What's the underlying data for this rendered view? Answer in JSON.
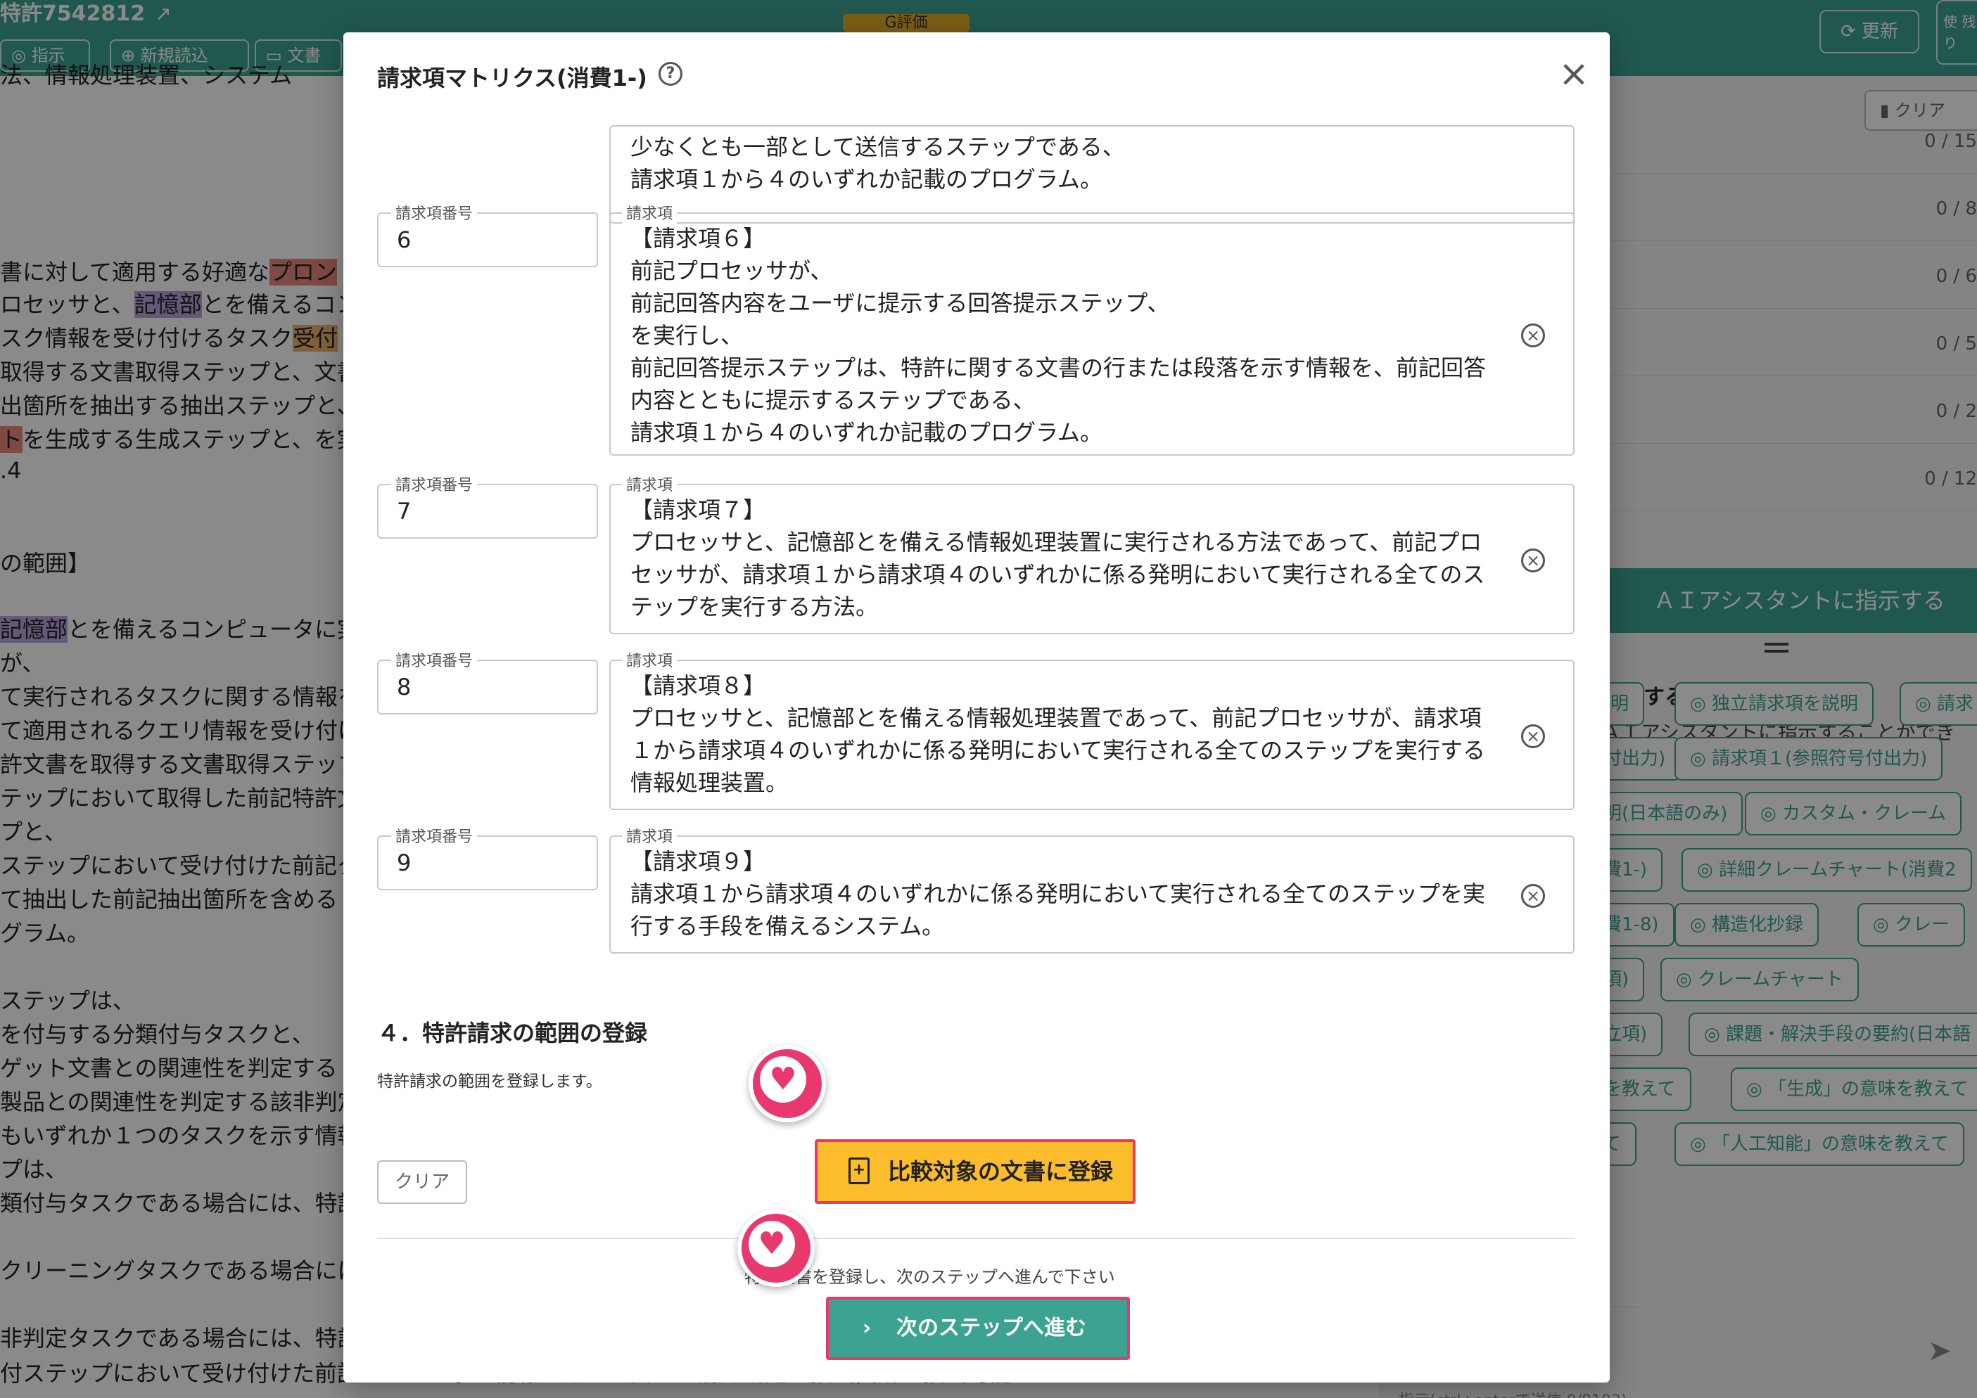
{
  "app": {
    "title": "特許7542812",
    "toolbar": [
      "指示",
      "新規読込",
      "文書"
    ],
    "rating": "G評価",
    "update_label": "更新",
    "remaining_label": "使 残り"
  },
  "doc_lines": [
    {
      "text": "法、情報処理装置、システム"
    },
    {
      "text": "書に対して適用する好適な",
      "hl": "プロン",
      "hlclass": "hl-red"
    },
    {
      "text": "ロセッサと、",
      "hl": "記憶部",
      "hlclass": "hl-purple",
      "after": "とを備えるコン"
    },
    {
      "text": "スク情報を受け付けるタスク",
      "hl": "受付",
      "hlclass": "hl-orange"
    },
    {
      "text": "取得する文書取得ステップと、文書"
    },
    {
      "text": "出箇所を抽出する抽出ステップと、"
    },
    {
      "text": "",
      "hl": "ト",
      "hlclass": "hl-red",
      "after": "を生成する生成ステップと、を実"
    },
    {
      "text": ".4"
    },
    {
      "text": "の範囲】"
    },
    {
      "text": "",
      "hl": "記憶部",
      "hlclass": "hl-purple",
      "after": "とを備えるコンピュータに実"
    },
    {
      "text": "が、"
    },
    {
      "text": "て実行されるタスクに関する情報を"
    },
    {
      "text": "て適用されるクエリ情報を受け付け"
    },
    {
      "text": "許文書を取得する文書取得ステップ"
    },
    {
      "text": "テップにおいて取得した前記特許文"
    },
    {
      "text": "プと、"
    },
    {
      "text": "ステップにおいて受け付けた前記ク"
    },
    {
      "text": "て抽出した前記抽出箇所を含める"
    },
    {
      "text": "グラム。"
    },
    {
      "text": "ステップは、"
    },
    {
      "text": "を付与する分類付与タスクと、"
    },
    {
      "text": "ゲット文書との関連性を判定する"
    },
    {
      "text": "製品との関連性を判定する該非判定"
    },
    {
      "text": "もいずれか１つのタスクを示す情報"
    },
    {
      "text": "プは、"
    },
    {
      "text": "類付与タスクである場合には、特許"
    },
    {
      "text": "クリーニングタスクである場合には"
    },
    {
      "text": "非判定タスクである場合には、特許"
    },
    {
      "text": "付ステップにおいて受け付けた前記タスクを示す情報に応じた異なる前記所定の抽出箇所を抽出可能"
    }
  ],
  "right_panel": {
    "clear_label": "クリア",
    "counts": [
      "0 / 15",
      "0 / 8",
      "0 / 6",
      "0 / 5",
      "0 / 2",
      "0 / 12"
    ],
    "ai_button": "ＡＩアシスタントに指示する",
    "section_title": "指示する",
    "section_desc": "ＡＩアシスタントに指示することができ",
    "chips": [
      "説明",
      "独立請求項を説明",
      "請求",
      "号付出力)",
      "請求項１(参照符号付出力)",
      "説明(日本語のみ)",
      "カスタム・クレーム",
      "消費1-)",
      "詳細クレームチャート(消費2",
      "消費1-8)",
      "構造化抄録",
      "クレー",
      "立項)",
      "クレームチャート",
      "独立項)",
      "課題・解決手段の要約(日本語",
      "味を教えて",
      "「生成」の意味を教えて",
      "えて",
      "「人工知能」の意味を教えて"
    ],
    "send_hint": "指示(ctrl+enterで送信  0/8192)"
  },
  "modal": {
    "title": "請求項マトリクス(消費1-)",
    "number_label": "請求項番号",
    "claim_label": "請求項",
    "partial_claim": [
      "少なくとも一部として送信するステップである、",
      "請求項１から４のいずれか記載のプログラム。"
    ],
    "claims": [
      {
        "number": "6",
        "lines": [
          "【請求項６】",
          "前記プロセッサが、",
          "前記回答内容をユーザに提示する回答提示ステップ、",
          "を実行し、",
          "前記回答提示ステップは、特許に関する文書の行または段落を示す情報を、前記回答",
          "内容とともに提示するステップである、",
          "請求項１から４のいずれか記載のプログラム。"
        ]
      },
      {
        "number": "7",
        "lines": [
          "【請求項７】",
          "プロセッサと、記憶部とを備える情報処理装置に実行される方法であって、前記プロ",
          "セッサが、請求項１から請求項４のいずれかに係る発明において実行される全てのス",
          "テップを実行する方法。"
        ]
      },
      {
        "number": "8",
        "lines": [
          "【請求項８】",
          "プロセッサと、記憶部とを備える情報処理装置であって、前記プロセッサが、請求項",
          "１から請求項４のいずれかに係る発明において実行される全てのステップを実行する",
          "情報処理装置。"
        ]
      },
      {
        "number": "9",
        "lines": [
          "【請求項９】",
          "請求項１から請求項４のいずれかに係る発明において実行される全てのステップを実",
          "行する手段を備えるシステム。"
        ]
      }
    ],
    "section_title": "４．特許請求の範囲の登録",
    "section_desc": "特許請求の範囲を登録します。",
    "clear_label": "クリア",
    "register_label": "比較対象の文書に登録",
    "hint": "特許文書を登録し、次のステップへ進んで下さい",
    "next_label": "次のステップへ進む",
    "accent": "#3ca392",
    "highlight": "#e8386e"
  }
}
